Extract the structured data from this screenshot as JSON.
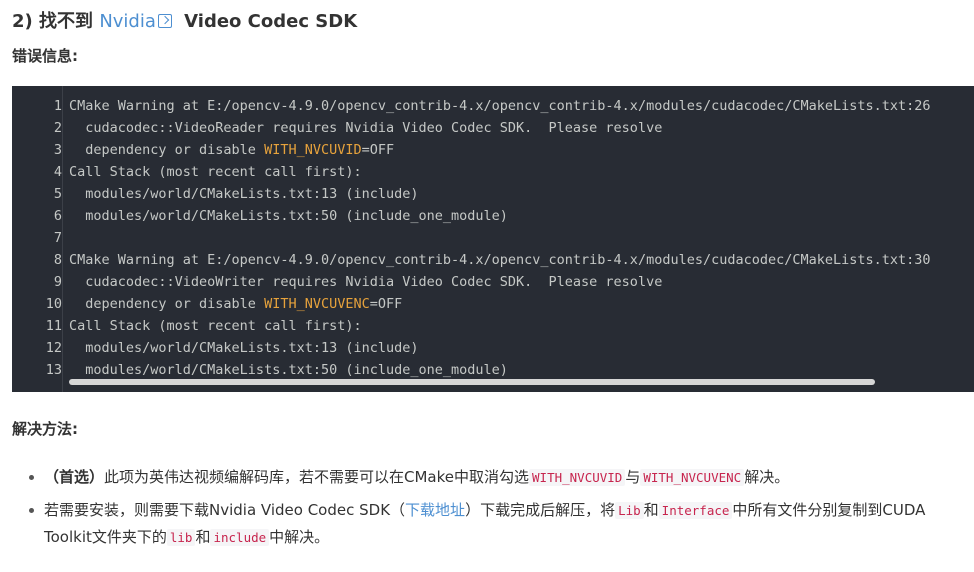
{
  "heading": {
    "prefix": "2) 找不到",
    "link_text": "Nvidia",
    "suffix": "Video Codec SDK"
  },
  "error_label": "错误信息:",
  "code_lines": [
    {
      "n": "1",
      "parts": [
        "CMake Warning at E:/opencv-4.9.0/opencv_contrib-4.x/opencv_contrib-4.x/modules/cudacodec/CMakeLists.txt:26"
      ]
    },
    {
      "n": "2",
      "parts": [
        "  cudacodec::VideoReader requires Nvidia Video Codec SDK.  Please resolve"
      ]
    },
    {
      "n": "3",
      "parts": [
        "  dependency or disable ",
        "WITH_NVCUVID",
        "=OFF"
      ]
    },
    {
      "n": "4",
      "parts": [
        "Call Stack (most recent call first):"
      ]
    },
    {
      "n": "5",
      "parts": [
        "  modules/world/CMakeLists.txt:13 (include)"
      ]
    },
    {
      "n": "6",
      "parts": [
        "  modules/world/CMakeLists.txt:50 (include_one_module)"
      ]
    },
    {
      "n": "7",
      "parts": [
        ""
      ]
    },
    {
      "n": "8",
      "parts": [
        "CMake Warning at E:/opencv-4.9.0/opencv_contrib-4.x/opencv_contrib-4.x/modules/cudacodec/CMakeLists.txt:30"
      ]
    },
    {
      "n": "9",
      "parts": [
        "  cudacodec::VideoWriter requires Nvidia Video Codec SDK.  Please resolve"
      ]
    },
    {
      "n": "10",
      "parts": [
        "  dependency or disable ",
        "WITH_NVCUVENC",
        "=OFF"
      ]
    },
    {
      "n": "11",
      "parts": [
        "Call Stack (most recent call first):"
      ]
    },
    {
      "n": "12",
      "parts": [
        "  modules/world/CMakeLists.txt:13 (include)"
      ]
    },
    {
      "n": "13",
      "parts": [
        "  modules/world/CMakeLists.txt:50 (include_one_module)"
      ]
    }
  ],
  "solution_label": "解决方法:",
  "bullet1": {
    "t1": "（首选）",
    "t2": "此项为英伟达视频编解码库，若不需要可以在CMake中取消勾选",
    "c1": "WITH_NVCUVID",
    "t3": "与",
    "c2": "WITH_NVCUVENC",
    "t4": "解决。"
  },
  "bullet2": {
    "t1": "若需要安装，则需要下载Nvidia Video Codec SDK（",
    "link": "下载地址",
    "t2": "）下载完成后解压，将",
    "c1": "Lib",
    "t3": "和",
    "c2": "Interface",
    "t4": "中所有文件分别复制到CUDA Toolkit文件夹下的",
    "c3": "lib",
    "t5": "和",
    "c4": "include",
    "t6": "中解决。"
  },
  "colors": {
    "code_bg": "#282c34",
    "highlight": "#e6a23c",
    "link": "#4d8fd1",
    "inline_code": "#c7254e"
  }
}
